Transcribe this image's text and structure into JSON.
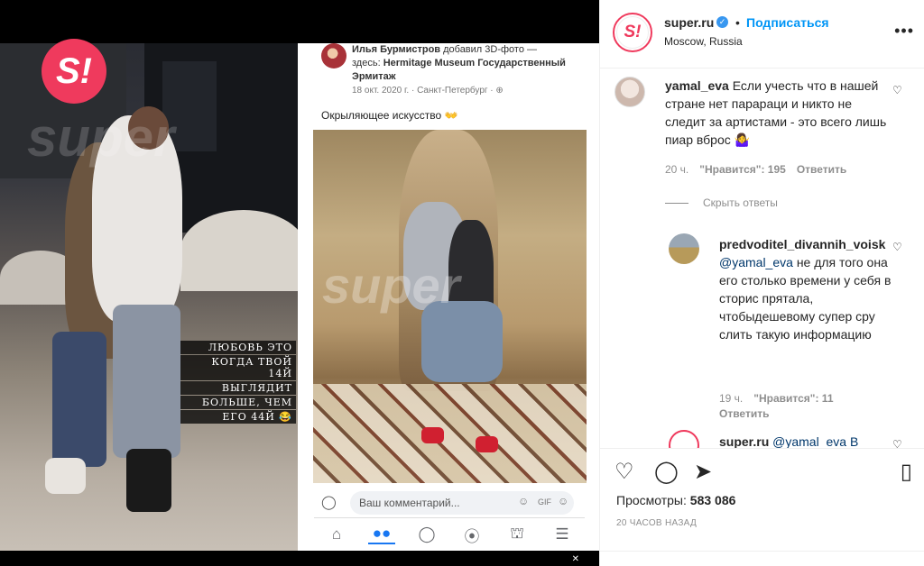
{
  "media": {
    "logo_text": "S!",
    "watermark": "super",
    "story_caption_lines": [
      "ЛЮБОВЬ ЭТО",
      "КОГДА ТВОЙ 14Й",
      "ВЫГЛЯДИТ",
      "БОЛЬШЕ, ЧЕМ",
      "ЕГО 44Й 😂"
    ],
    "fb_post": {
      "author": "Илья Бурмистров",
      "action_text": "добавил 3D-фото —",
      "location_prefix": "здесь:",
      "location": "Hermitage Museum Государственный Эрмитаж",
      "meta": "18 окт. 2020 г. · Санкт-Петербург · ⊕",
      "text": "Окрыляющее искусство 👐",
      "comment_placeholder": "Ваш комментарий...",
      "watermark": "super"
    }
  },
  "header": {
    "avatar_text": "S!",
    "username": "super.ru",
    "dot": "•",
    "follow": "Подписаться",
    "location": "Moscow, Russia",
    "more_icon": "more-icon"
  },
  "comments": [
    {
      "username": "yamal_eva",
      "text": "Если учесть что в нашей стране нет парараци и никто не следит за артистами - это всего лишь пиар вброс 🤷‍♀️",
      "time": "20 ч.",
      "likes": "\"Нравится\": 195",
      "reply": "Ответить"
    }
  ],
  "hide_replies": "Скрыть ответы",
  "reply": {
    "username": "predvoditel_divannih_voisk",
    "mention": "@yamal_eva",
    "text": "не для того она его столько времени у себя в сторис прятала, чтобыдешевому супер сру слить такую информацию",
    "time": "19 ч.",
    "likes": "\"Нравится\": 11",
    "reply": "Ответить"
  },
  "partial_comment": {
    "username": "super.ru",
    "text": "@yamal_eva В"
  },
  "actions": {
    "views_label": "Просмотры:",
    "views_value": "583 086",
    "posted": "20 ЧАСОВ НАЗАД"
  },
  "colors": {
    "brand": "#ef3a5d",
    "link": "#0095f6",
    "fb_blue": "#1877f2"
  }
}
